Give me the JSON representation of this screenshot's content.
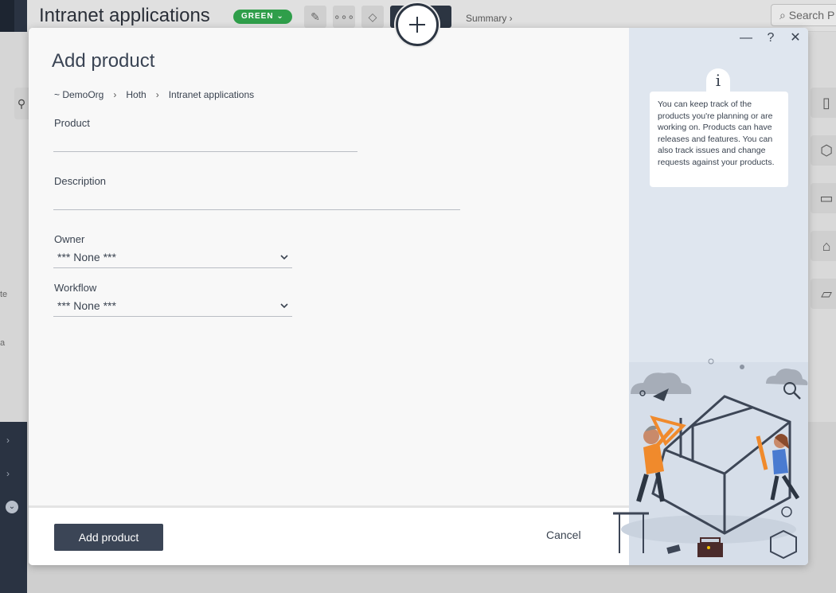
{
  "background": {
    "app_title": "Intranet applications",
    "status_badge": "GREEN",
    "summary_link": "Summary ›",
    "search_placeholder": "Search P",
    "left_text_1": "te",
    "left_text_2": "a"
  },
  "modal": {
    "title": "Add product",
    "breadcrumb": [
      "~ DemoOrg",
      "Hoth",
      "Intranet applications"
    ],
    "fields": {
      "product_label": "Product",
      "product_value": "",
      "description_label": "Description",
      "description_value": "",
      "owner_label": "Owner",
      "owner_value": "*** None ***",
      "workflow_label": "Workflow",
      "workflow_value": "*** None ***"
    },
    "footer": {
      "submit_label": "Add product",
      "cancel_label": "Cancel"
    },
    "window_controls": {
      "minimize": "—",
      "help": "?",
      "close": "✕"
    },
    "help": {
      "icon_letter": "i",
      "text": "You can keep track of the products you're planning or are working on. Products can have releases and features. You can also track issues and change requests against your products."
    }
  },
  "colors": {
    "primary_button": "#3b4556",
    "status_green": "#2f9e4a",
    "help_panel_bg": "#dfe6ef",
    "illustration_orange": "#f08a2c"
  },
  "icons": [
    "plus-icon",
    "chevron-down-icon",
    "edit-icon",
    "more-icon",
    "tag-icon",
    "search-icon",
    "book-icon",
    "box-icon",
    "bell-icon",
    "folder-icon",
    "tree-icon"
  ]
}
